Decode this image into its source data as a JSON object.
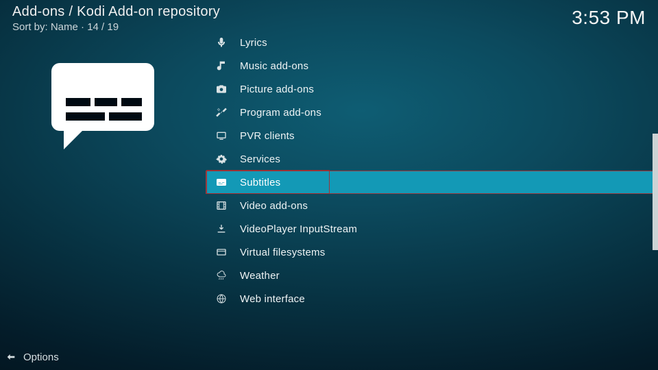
{
  "breadcrumb": {
    "path": "Add-ons / Kodi Add-on repository"
  },
  "sort": {
    "label": "Sort by: Name  ·  14 / 19"
  },
  "clock": {
    "time": "3:53 PM"
  },
  "categories": [
    {
      "icon": "mic",
      "label": "Lyrics"
    },
    {
      "icon": "music",
      "label": "Music add-ons"
    },
    {
      "icon": "camera",
      "label": "Picture add-ons"
    },
    {
      "icon": "tools",
      "label": "Program add-ons"
    },
    {
      "icon": "tv",
      "label": "PVR clients"
    },
    {
      "icon": "gear",
      "label": "Services"
    },
    {
      "icon": "subtitles",
      "label": "Subtitles",
      "selected": true,
      "highlighted": true
    },
    {
      "icon": "film",
      "label": "Video add-ons"
    },
    {
      "icon": "download",
      "label": "VideoPlayer InputStream"
    },
    {
      "icon": "folder",
      "label": "Virtual filesystems"
    },
    {
      "icon": "weather",
      "label": "Weather"
    },
    {
      "icon": "globe",
      "label": "Web interface"
    }
  ],
  "footer": {
    "options": "Options"
  }
}
